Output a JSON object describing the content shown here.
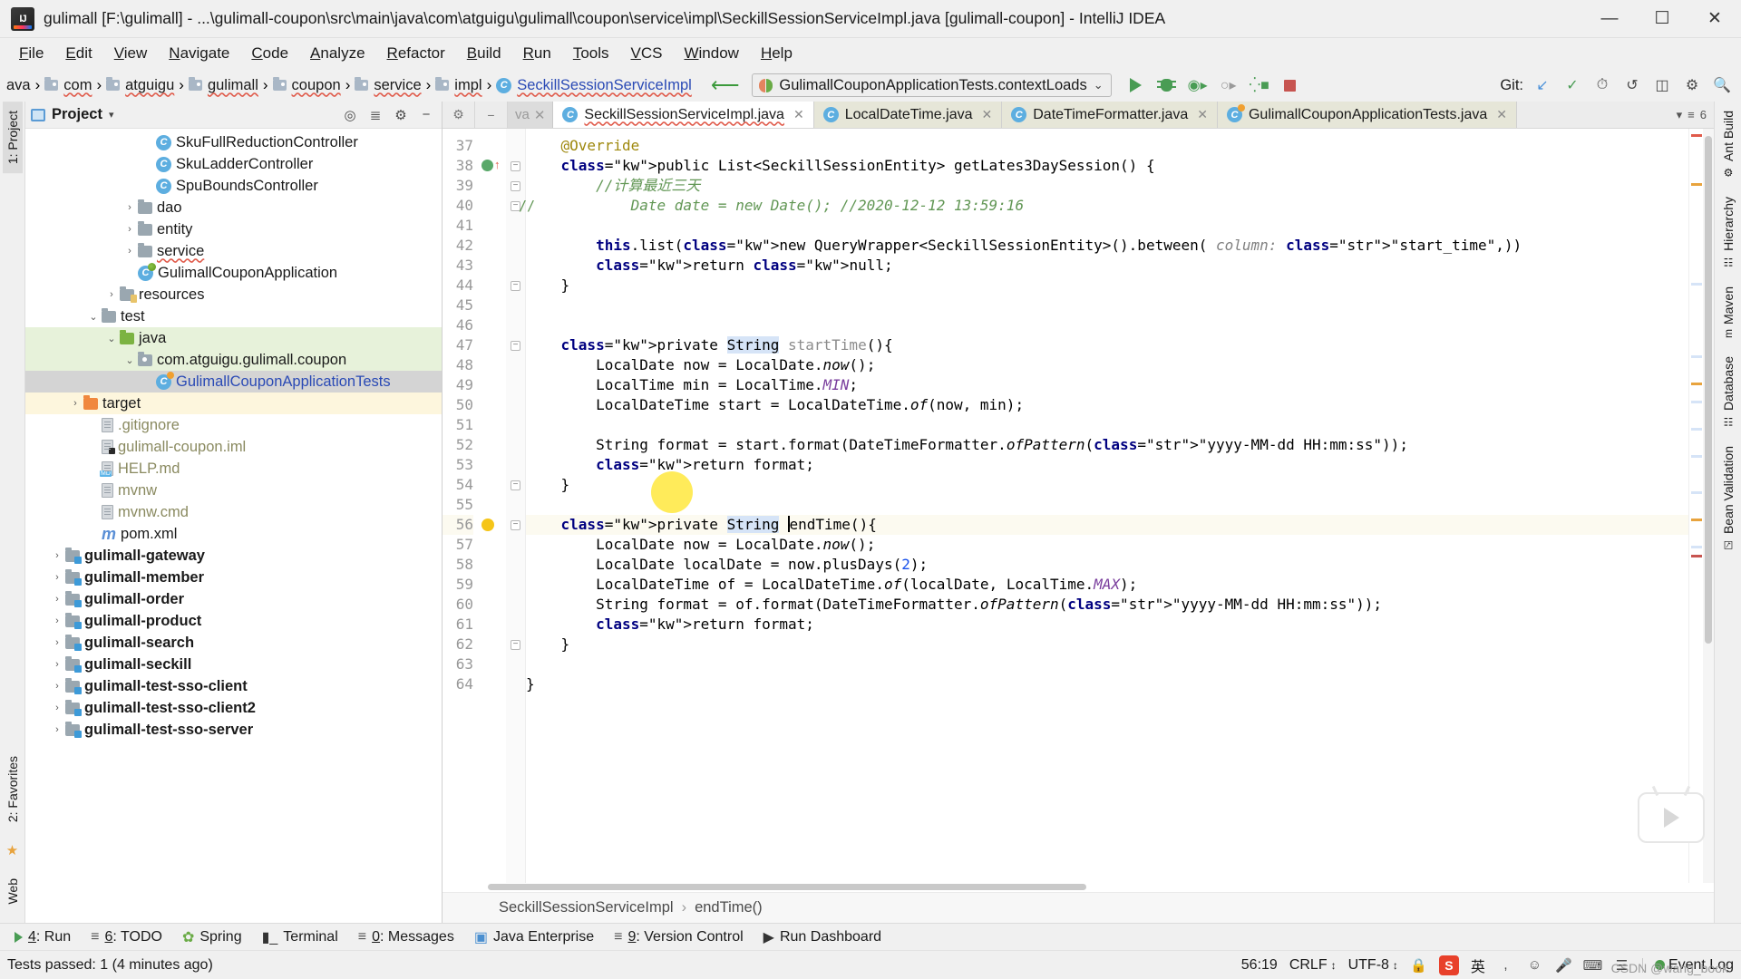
{
  "window": {
    "title": "gulimall [F:\\gulimall] - ...\\gulimall-coupon\\src\\main\\java\\com\\atguigu\\gulimall\\coupon\\service\\impl\\SeckillSessionServiceImpl.java [gulimall-coupon] - IntelliJ IDEA",
    "minimize": "—",
    "maximize": "☐",
    "close": "✕",
    "logo_text": "IJ"
  },
  "menu": [
    "File",
    "Edit",
    "View",
    "Navigate",
    "Code",
    "Analyze",
    "Refactor",
    "Build",
    "Run",
    "Tools",
    "VCS",
    "Window",
    "Help"
  ],
  "breadcrumbs": [
    {
      "label": "ava",
      "icon": "none"
    },
    {
      "label": "com",
      "icon": "folder-icon"
    },
    {
      "label": "atguigu",
      "icon": "folder-icon"
    },
    {
      "label": "gulimall",
      "icon": "folder-icon"
    },
    {
      "label": "coupon",
      "icon": "folder-icon"
    },
    {
      "label": "service",
      "icon": "folder-icon"
    },
    {
      "label": "impl",
      "icon": "folder-icon"
    },
    {
      "label": "SeckillSessionServiceImpl",
      "icon": "class-icon"
    }
  ],
  "run_config": {
    "name": "GulimallCouponApplicationTests.contextLoads",
    "caret": "⌄",
    "icon": "spring-test-icon"
  },
  "toolbar_icons": [
    "run-icon",
    "debug-icon",
    "run-with-coverage-icon",
    "profile-icon",
    "run-tests-icon",
    "stop-icon"
  ],
  "vcs": {
    "label": "Git:",
    "icons": [
      "update-project-icon",
      "commit-icon",
      "history-icon",
      "rollback-icon",
      "compare-icon",
      "settings-icon",
      "search-icon"
    ]
  },
  "project_panel": {
    "title": "Project",
    "caret": "▾",
    "actions": [
      "locate-icon",
      "expand-collapse-icon",
      "settings-icon",
      "hide-icon"
    ],
    "tree": [
      {
        "label": "SkuFullReductionController",
        "indent": 7,
        "icon": "class-icon",
        "arrow": "",
        "style": "plain"
      },
      {
        "label": "SkuLadderController",
        "indent": 7,
        "icon": "class-icon",
        "arrow": "",
        "style": "plain"
      },
      {
        "label": "SpuBoundsController",
        "indent": 7,
        "icon": "class-icon",
        "arrow": "",
        "style": "plain"
      },
      {
        "label": "dao",
        "indent": 6,
        "icon": "folder-grey-icon",
        "arrow": "›",
        "style": "plain"
      },
      {
        "label": "entity",
        "indent": 6,
        "icon": "folder-grey-icon",
        "arrow": "›",
        "style": "plain"
      },
      {
        "label": "service",
        "indent": 6,
        "icon": "folder-grey-icon",
        "arrow": "›",
        "style": "squiggle"
      },
      {
        "label": "GulimallCouponApplication",
        "indent": 6,
        "icon": "spring-class-icon",
        "arrow": "",
        "style": "plain"
      },
      {
        "label": "resources",
        "indent": 5,
        "icon": "folder-resources-icon",
        "arrow": "›",
        "style": "plain"
      },
      {
        "label": "test",
        "indent": 4,
        "icon": "folder-grey-icon",
        "arrow": "⌄",
        "style": "plain"
      },
      {
        "label": "java",
        "indent": 5,
        "icon": "folder-green-icon",
        "arrow": "⌄",
        "style": "plain",
        "row": "hl-green"
      },
      {
        "label": "com.atguigu.gulimall.coupon",
        "indent": 6,
        "icon": "package-icon",
        "arrow": "⌄",
        "style": "plain",
        "row": "hl-green"
      },
      {
        "label": "GulimallCouponApplicationTests",
        "indent": 7,
        "icon": "test-class-icon",
        "arrow": "",
        "style": "link",
        "row": "sel"
      },
      {
        "label": "target",
        "indent": 3,
        "icon": "folder-orange-icon",
        "arrow": "›",
        "style": "plain",
        "row": "hl-yellow"
      },
      {
        "label": ".gitignore",
        "indent": 4,
        "icon": "file-icon",
        "arrow": "",
        "style": "muted"
      },
      {
        "label": "gulimall-coupon.iml",
        "indent": 4,
        "icon": "iml-file-icon",
        "arrow": "",
        "style": "muted"
      },
      {
        "label": "HELP.md",
        "indent": 4,
        "icon": "md-file-icon",
        "arrow": "",
        "style": "muted"
      },
      {
        "label": "mvnw",
        "indent": 4,
        "icon": "file-icon",
        "arrow": "",
        "style": "muted"
      },
      {
        "label": "mvnw.cmd",
        "indent": 4,
        "icon": "file-icon",
        "arrow": "",
        "style": "muted"
      },
      {
        "label": "pom.xml",
        "indent": 4,
        "icon": "maven-icon",
        "arrow": "",
        "style": "plain"
      },
      {
        "label": "gulimall-gateway",
        "indent": 2,
        "icon": "module-icon",
        "arrow": "›",
        "style": "bold"
      },
      {
        "label": "gulimall-member",
        "indent": 2,
        "icon": "module-icon",
        "arrow": "›",
        "style": "bold"
      },
      {
        "label": "gulimall-order",
        "indent": 2,
        "icon": "module-icon",
        "arrow": "›",
        "style": "bold"
      },
      {
        "label": "gulimall-product",
        "indent": 2,
        "icon": "module-icon",
        "arrow": "›",
        "style": "bold"
      },
      {
        "label": "gulimall-search",
        "indent": 2,
        "icon": "module-icon",
        "arrow": "›",
        "style": "bold"
      },
      {
        "label": "gulimall-seckill",
        "indent": 2,
        "icon": "module-icon",
        "arrow": "›",
        "style": "bold"
      },
      {
        "label": "gulimall-test-sso-client",
        "indent": 2,
        "icon": "module-icon",
        "arrow": "›",
        "style": "bold"
      },
      {
        "label": "gulimall-test-sso-client2",
        "indent": 2,
        "icon": "module-icon",
        "arrow": "›",
        "style": "bold"
      },
      {
        "label": "gulimall-test-sso-server",
        "indent": 2,
        "icon": "module-icon",
        "arrow": "›",
        "style": "bold"
      }
    ]
  },
  "left_rail": {
    "top": [
      "1: Project"
    ],
    "bottom": [
      "2: Favorites",
      "Web"
    ]
  },
  "right_rail": [
    "Ant Build",
    "Hierarchy",
    "Maven",
    "Database",
    "Bean Validation"
  ],
  "tabs": [
    {
      "label": "va",
      "active": false,
      "truncated": true,
      "close": "✕"
    },
    {
      "label": "SeckillSessionServiceImpl.java",
      "active": true,
      "icon": "class-icon",
      "close": "✕",
      "squiggle": true
    },
    {
      "label": "LocalDateTime.java",
      "active": false,
      "icon": "class-icon",
      "close": "✕"
    },
    {
      "label": "DateTimeFormatter.java",
      "active": false,
      "icon": "class-icon",
      "close": "✕"
    },
    {
      "label": "GulimallCouponApplicationTests.java",
      "active": false,
      "icon": "test-class-icon",
      "close": "✕"
    }
  ],
  "tabbar_right": {
    "count": "6",
    "icon": "list-icon"
  },
  "editor": {
    "first_line": 37,
    "lines": [
      {
        "n": 37,
        "text": "@Override",
        "kind": "annotation",
        "indent": 2
      },
      {
        "n": 38,
        "text": "public List<SeckillSessionEntity> getLates3DaySession() {",
        "indent": 2,
        "marker": "run-gutter-icon"
      },
      {
        "n": 39,
        "text": "//计算最近三天",
        "indent": 3,
        "kind": "comment-green"
      },
      {
        "n": 40,
        "text": "Date date = new Date(); //2020-12-12 13:59:16",
        "indent": 4,
        "kind": "commented-out",
        "prefix": "//"
      },
      {
        "n": 41,
        "text": "",
        "indent": 0
      },
      {
        "n": 42,
        "text": "this.list(new QueryWrapper<SeckillSessionEntity>().between( column: \"start_time\",))",
        "indent": 3
      },
      {
        "n": 43,
        "text": "return null;",
        "indent": 3
      },
      {
        "n": 44,
        "text": "}",
        "indent": 2
      },
      {
        "n": 45,
        "text": "",
        "indent": 0
      },
      {
        "n": 46,
        "text": "",
        "indent": 0
      },
      {
        "n": 47,
        "text": "private String startTime(){",
        "indent": 2
      },
      {
        "n": 48,
        "text": "LocalDate now = LocalDate.now();",
        "indent": 3
      },
      {
        "n": 49,
        "text": "LocalTime min = LocalTime.MIN;",
        "indent": 3
      },
      {
        "n": 50,
        "text": "LocalDateTime start = LocalDateTime.of(now, min);",
        "indent": 3
      },
      {
        "n": 51,
        "text": "",
        "indent": 0
      },
      {
        "n": 52,
        "text": "String format = start.format(DateTimeFormatter.ofPattern(\"yyyy-MM-dd HH:mm:ss\"));",
        "indent": 3
      },
      {
        "n": 53,
        "text": "return format;",
        "indent": 3
      },
      {
        "n": 54,
        "text": "}",
        "indent": 2
      },
      {
        "n": 55,
        "text": "",
        "indent": 0
      },
      {
        "n": 56,
        "text": "private String endTime(){",
        "indent": 2,
        "marker": "intention-bulb-icon",
        "current": true
      },
      {
        "n": 57,
        "text": "LocalDate now = LocalDate.now();",
        "indent": 3
      },
      {
        "n": 58,
        "text": "LocalDate localDate = now.plusDays(2);",
        "indent": 3
      },
      {
        "n": 59,
        "text": "LocalDateTime of = LocalDateTime.of(localDate, LocalTime.MAX);",
        "indent": 3
      },
      {
        "n": 60,
        "text": "String format = of.format(DateTimeFormatter.ofPattern(\"yyyy-MM-dd HH:mm:ss\"));",
        "indent": 3
      },
      {
        "n": 61,
        "text": "return format;",
        "indent": 3
      },
      {
        "n": 62,
        "text": "}",
        "indent": 2
      },
      {
        "n": 63,
        "text": "",
        "indent": 0
      },
      {
        "n": 64,
        "text": "}",
        "indent": 1
      }
    ],
    "breadcrumb": [
      "SeckillSessionServiceImpl",
      "endTime()"
    ],
    "breadcrumb_sep": "›"
  },
  "bottom_toolwindows": [
    {
      "key": "4",
      "label": "Run",
      "icon": "run-icon"
    },
    {
      "key": "6",
      "label": "TODO",
      "icon": "todo-icon"
    },
    {
      "key": "",
      "label": "Spring",
      "icon": "spring-icon"
    },
    {
      "key": "",
      "label": "Terminal",
      "icon": "terminal-icon"
    },
    {
      "key": "0",
      "label": "Messages",
      "icon": "messages-icon"
    },
    {
      "key": "",
      "label": "Java Enterprise",
      "icon": "java-ee-icon"
    },
    {
      "key": "9",
      "label": "Version Control",
      "icon": "version-control-icon"
    },
    {
      "key": "",
      "label": "Run Dashboard",
      "icon": "run-dashboard-icon"
    }
  ],
  "statusbar": {
    "message": "Tests passed: 1 (4 minutes ago)",
    "caret_position": "56:19",
    "line_separator": "CRLF",
    "encoding": "UTF-8",
    "indent_caret": "↕",
    "ime": {
      "app": "S",
      "mode": "英",
      "icons": [
        "comma-icon",
        "smiley-icon",
        "mic-icon",
        "keyboard-icon",
        "menu-icon"
      ]
    },
    "event_log": "Event Log",
    "lock_icon": "lock-icon",
    "watermark": "CSDN @wang_book"
  }
}
